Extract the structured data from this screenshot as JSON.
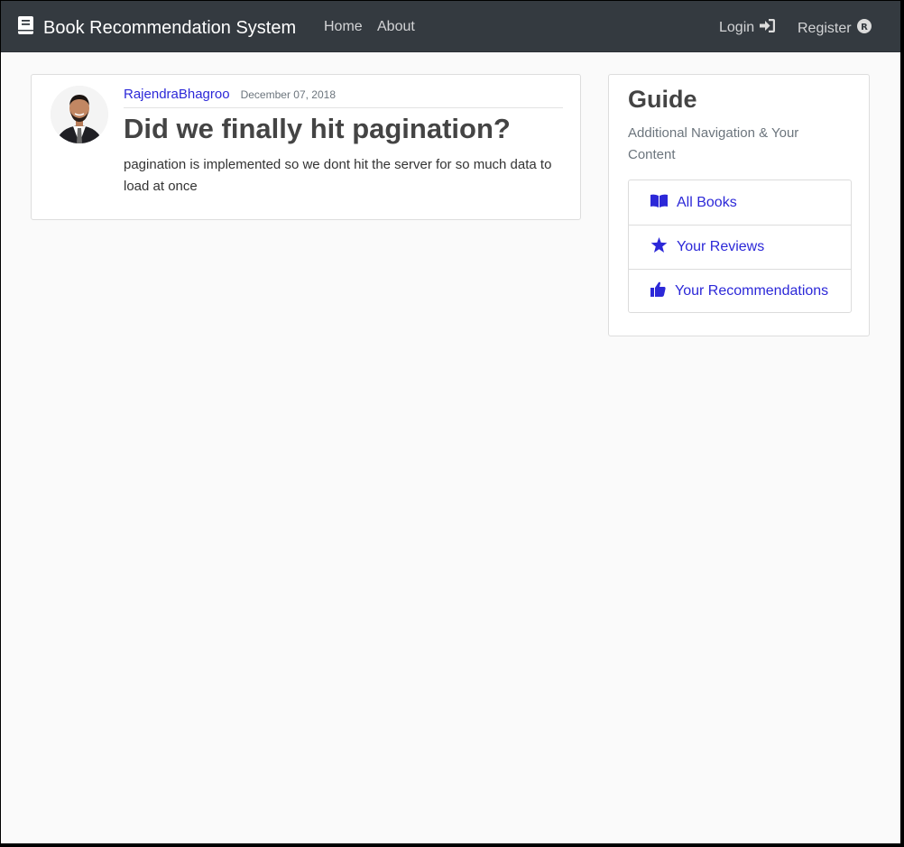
{
  "navbar": {
    "brand": "Book Recommendation System",
    "brand_icon": "book-icon",
    "links": {
      "home": "Home",
      "about": "About",
      "login": "Login",
      "register": "Register"
    },
    "background": "#343a40"
  },
  "post": {
    "author": "RajendraBhagroo",
    "date": "December 07, 2018",
    "title": "Did we finally hit pagination?",
    "content": "pagination is implemented so we dont hit the server for so much data to load at once"
  },
  "sidebar": {
    "title": "Guide",
    "subtitle": "Additional Navigation & Your Content",
    "items": [
      {
        "label": "All Books",
        "icon": "open-book-icon"
      },
      {
        "label": "Your Reviews",
        "icon": "star-icon"
      },
      {
        "label": "Your Recommendations",
        "icon": "thumbs-up-icon"
      }
    ]
  },
  "colors": {
    "accent": "#2c28d8",
    "page_background": "#fafafa"
  }
}
